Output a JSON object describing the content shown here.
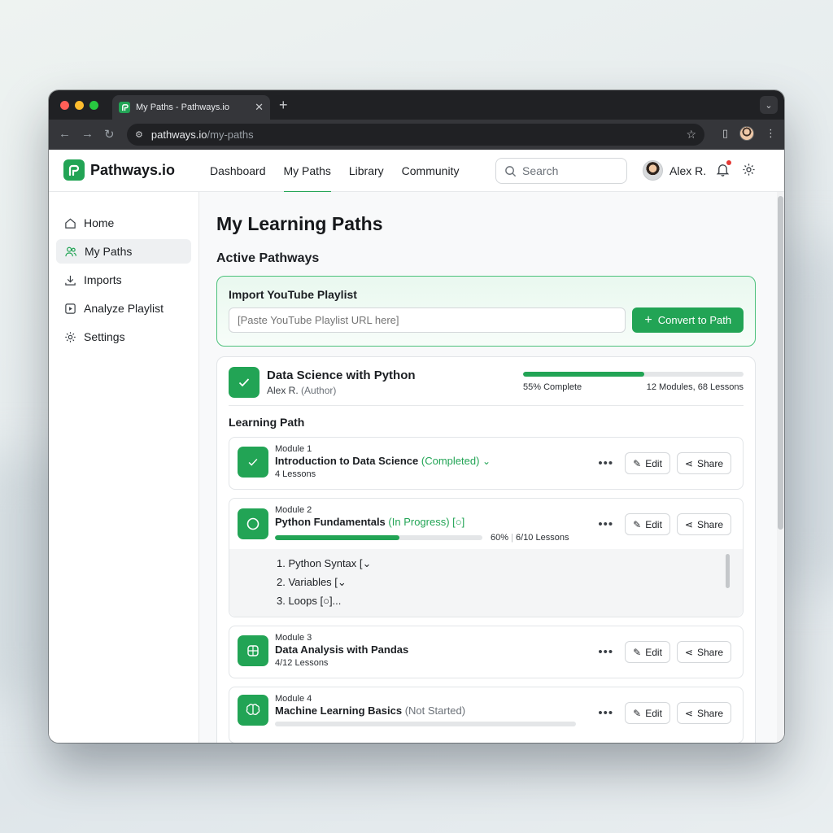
{
  "browser": {
    "tab_title": "My Paths - Pathways.io",
    "url_host": "pathways.io",
    "url_path": "/my-paths"
  },
  "header": {
    "brand": "Pathways.io",
    "nav": [
      "Dashboard",
      "My Paths",
      "Library",
      "Community"
    ],
    "active_nav": "My Paths",
    "search_placeholder": "Search",
    "user_name": "Alex R."
  },
  "sidebar": {
    "items": [
      {
        "label": "Home",
        "icon": "home-icon"
      },
      {
        "label": "My Paths",
        "icon": "users-icon"
      },
      {
        "label": "Imports",
        "icon": "download-icon"
      },
      {
        "label": "Analyze Playlist",
        "icon": "play-square-icon"
      },
      {
        "label": "Settings",
        "icon": "gear-icon"
      }
    ],
    "active": "My Paths"
  },
  "main": {
    "title": "My Learning Paths",
    "section": "Active Pathways",
    "import": {
      "title": "Import YouTube Playlist",
      "placeholder": "[Paste YouTube Playlist URL here]",
      "button": "Convert to Path"
    },
    "path": {
      "name": "Data Science with Python",
      "author": "Alex R.",
      "author_role": "(Author)",
      "progress": 55,
      "progress_label": "55% Complete",
      "stats": "12 Modules, 68 Lessons",
      "learning_path_label": "Learning Path"
    },
    "modules": [
      {
        "num": "Module 1",
        "name": "Introduction to Data Science",
        "status": "(Completed)",
        "status_color": "green",
        "sub": "4 Lessons",
        "icon": "check-icon"
      },
      {
        "num": "Module 2",
        "name": "Python Fundamentals",
        "status": "(In Progress) [○]",
        "status_color": "green",
        "progress": 60,
        "progress_pct": "60%",
        "progress_lessons": "6/10 Lessons",
        "icon": "circle-icon",
        "lessons": [
          "1. Python Syntax [⌄",
          "2. Variables [⌄",
          "3. Loops [○]..."
        ]
      },
      {
        "num": "Module 3",
        "name": "Data Analysis with Pandas",
        "status": "",
        "sub": "4/12 Lessons",
        "icon": "table-icon"
      },
      {
        "num": "Module 4",
        "name": "Machine Learning Basics",
        "status": "(Not Started)",
        "status_color": "gray",
        "progress": 0,
        "icon": "brain-icon"
      }
    ],
    "actions": {
      "edit": "Edit",
      "share": "Share"
    }
  },
  "colors": {
    "accent": "#22a455",
    "accent_border": "#4cc17b",
    "browser_dark": "#202124"
  }
}
